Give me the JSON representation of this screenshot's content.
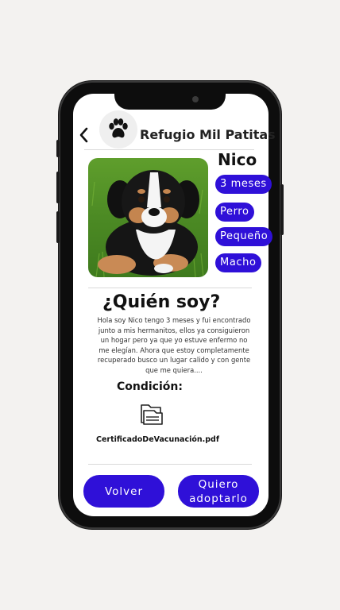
{
  "header": {
    "title": "Refugio Mil Patitas",
    "back_icon": "chevron-left-icon",
    "logo_icon": "paw-icon"
  },
  "pet": {
    "name": "Nico",
    "tags": [
      "3 meses",
      "Perro",
      "Pequeño",
      "Macho"
    ]
  },
  "about": {
    "heading": "¿Quién soy?",
    "text": "Hola soy Nico tengo 3 meses y fui encontrado junto a mis hermanitos, ellos ya consiguieron un hogar pero ya que yo estuve enfermo no me elegían. Ahora que estoy completamente recuperado busco un lugar calido y con gente que me quiera...."
  },
  "condition": {
    "label": "Condición:",
    "file_name": "CertificadoDeVacunación.pdf",
    "file_icon": "folder-icon"
  },
  "actions": {
    "back_label": "Volver",
    "adopt_line1": "Quiero",
    "adopt_line2": "adoptarlo"
  },
  "colors": {
    "accent": "#2f10d8"
  }
}
